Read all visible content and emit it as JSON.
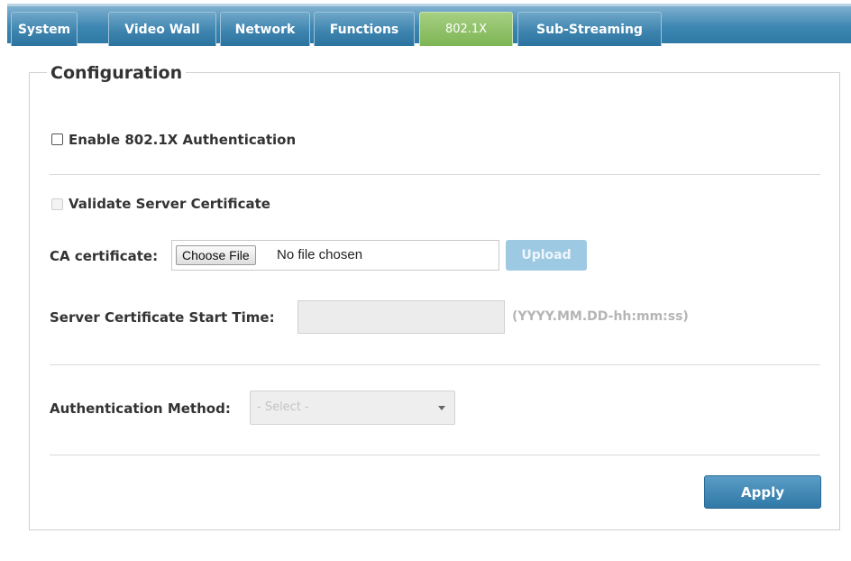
{
  "tabs": [
    {
      "label": "System",
      "active": false
    },
    {
      "label": "Video Wall",
      "active": false
    },
    {
      "label": "Network",
      "active": false
    },
    {
      "label": "Functions",
      "active": false
    },
    {
      "label": "802.1X",
      "active": true
    },
    {
      "label": "Sub-Streaming",
      "active": false
    }
  ],
  "config": {
    "legend": "Configuration",
    "enable_label": "Enable 802.1X Authentication",
    "enable_checked": false,
    "validate_label": "Validate Server Certificate",
    "validate_checked": false,
    "ca_label": "CA certificate:",
    "choose_file_label": "Choose File",
    "no_file_text": "No file chosen",
    "upload_label": "Upload",
    "start_time_label": "Server Certificate Start Time:",
    "start_time_value": "",
    "start_time_hint": "(YYYY.MM.DD-hh:mm:ss)",
    "auth_method_label": "Authentication Method:",
    "auth_method_selected": "- Select -",
    "apply_label": "Apply"
  },
  "colors": {
    "tab_blue": "#3d87b3",
    "tab_active_green": "#7db554",
    "apply_blue": "#2f78a6",
    "upload_disabled": "#9ec9e3"
  }
}
